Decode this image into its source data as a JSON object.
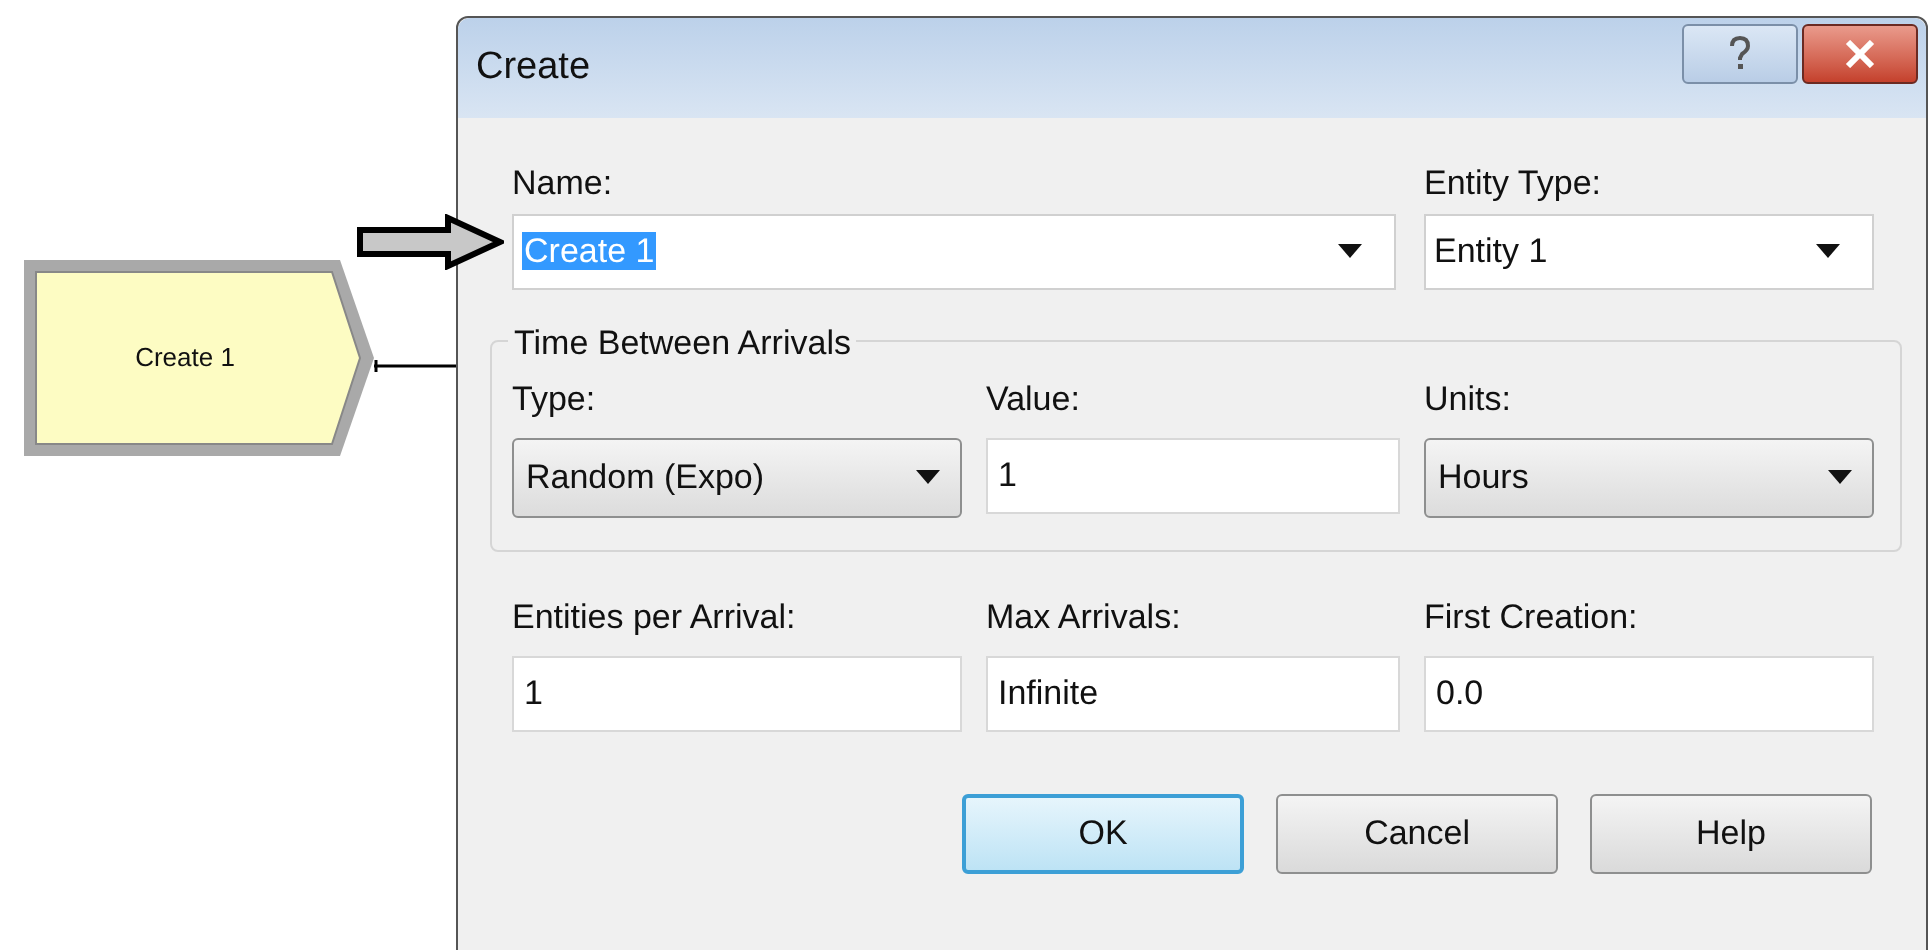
{
  "canvas": {
    "module": {
      "label": "Create 1"
    }
  },
  "dialog": {
    "title": "Create",
    "name": {
      "label": "Name:",
      "value": "Create 1",
      "kind": "editable_combo",
      "text_selected": true
    },
    "entity_type": {
      "label": "Entity Type:",
      "value": "Entity 1",
      "kind": "editable_combo"
    },
    "group": {
      "title": "Time Between Arrivals",
      "fields": [
        {
          "label": "Type:",
          "value": "Random (Expo)",
          "kind": "dropdown"
        },
        {
          "label": "Value:",
          "value": "1",
          "kind": "text"
        },
        {
          "label": "Units:",
          "value": "Hours",
          "kind": "dropdown"
        }
      ]
    },
    "fields": [
      {
        "label": "Entities per Arrival:",
        "value": "1",
        "kind": "text"
      },
      {
        "label": "Max Arrivals:",
        "value": "Infinite",
        "kind": "text"
      },
      {
        "label": "First Creation:",
        "value": "0.0",
        "kind": "text"
      }
    ],
    "buttons": [
      {
        "label": "OK",
        "default": true
      },
      {
        "label": "Cancel",
        "default": false
      },
      {
        "label": "Help",
        "default": false
      }
    ]
  }
}
